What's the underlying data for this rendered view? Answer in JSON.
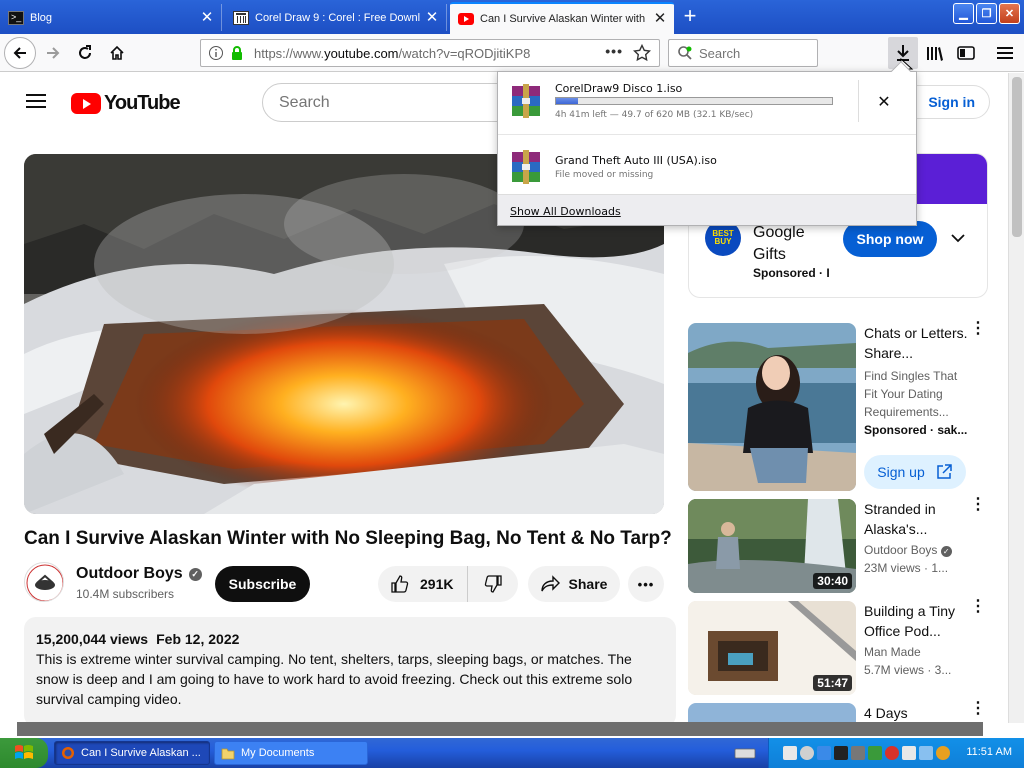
{
  "browser": {
    "tabs": [
      {
        "title": "Blog",
        "icon": "terminal-icon",
        "active": false
      },
      {
        "title": "Corel Draw 9 : Corel : Free Downl",
        "icon": "internet-archive-icon",
        "active": false
      },
      {
        "title": "Can I Survive Alaskan Winter with",
        "icon": "youtube-icon",
        "active": true
      }
    ],
    "url_prefix": "https://www.",
    "url_domain": "youtube.com",
    "url_path": "/watch?v=qRODjitiKP8",
    "search_placeholder": "Search"
  },
  "downloads": {
    "items": [
      {
        "name": "CorelDraw9 Disco 1.iso",
        "status": "4h 41m left — 49.7 of 620 MB (32.1 KB/sec)",
        "progress": 0.08,
        "icon": "winrar-icon"
      },
      {
        "name": "Grand Theft Auto III (USA).iso",
        "status": "File moved or missing",
        "icon": "winrar-icon"
      }
    ],
    "show_all": "Show All Downloads"
  },
  "youtube": {
    "logo": "YouTube",
    "search_placeholder": "Search",
    "signin": "Sign in",
    "video": {
      "title": "Can I Survive Alaskan Winter with No Sleeping Bag, No Tent & No Tarp?",
      "channel": "Outdoor Boys",
      "subscribers": "10.4M subscribers",
      "subscribe": "Subscribe",
      "likes": "291K",
      "share": "Share",
      "views": "15,200,044 views",
      "date": "Feb 12, 2022",
      "description": "This is extreme winter survival camping. No tent, shelters, tarps, sleeping bags, or matches. The snow is deep and I am going to have to work hard to avoid freezing. Check out this extreme solo survival camping video."
    },
    "ad": {
      "title": "Google Gifts",
      "sponsored": "Sponsored · I",
      "button": "Shop now",
      "logo_text": "BEST BUY"
    },
    "recommendations": [
      {
        "title": "Chats or Letters. Share...",
        "line1": "Find Singles That Fit Your Dating Requirements...",
        "line2": "Sponsored · sak...",
        "button": "Sign up"
      },
      {
        "title": "Stranded in Alaska's...",
        "channel": "Outdoor Boys",
        "meta": "23M views · 1...",
        "duration": "30:40"
      },
      {
        "title": "Building a Tiny Office Pod...",
        "channel": "Man Made",
        "meta": "5.7M views · 3...",
        "duration": "51:47"
      },
      {
        "title": "4 Days"
      }
    ]
  },
  "taskbar": {
    "tasks": [
      {
        "label": "Can I Survive Alaskan ...",
        "active": true
      },
      {
        "label": "My Documents",
        "active": false
      }
    ],
    "clock": "11:51 AM"
  }
}
